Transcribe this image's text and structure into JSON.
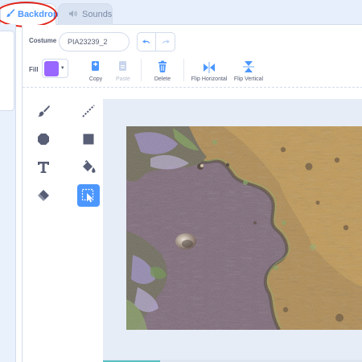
{
  "tabs": {
    "backdrops_label": "Backdrops",
    "sounds_label": "Sounds"
  },
  "costume": {
    "label": "Costume",
    "name_value": "PIA23239_2"
  },
  "fill": {
    "label": "Fill",
    "color": "#9966ff"
  },
  "toolbar": {
    "copy_label": "Copy",
    "paste_label": "Paste",
    "delete_label": "Delete",
    "flip_h_label": "Flip Horizontal",
    "flip_v_label": "Flip Vertical"
  },
  "palette": {
    "tools": [
      "brush",
      "line",
      "circle",
      "rectangle",
      "text",
      "fill",
      "eraser",
      "select"
    ],
    "selected": "select"
  },
  "colors": {
    "accent": "#4c97ff",
    "highlight_ring": "#e2251b",
    "delete": "#4c97ff"
  }
}
